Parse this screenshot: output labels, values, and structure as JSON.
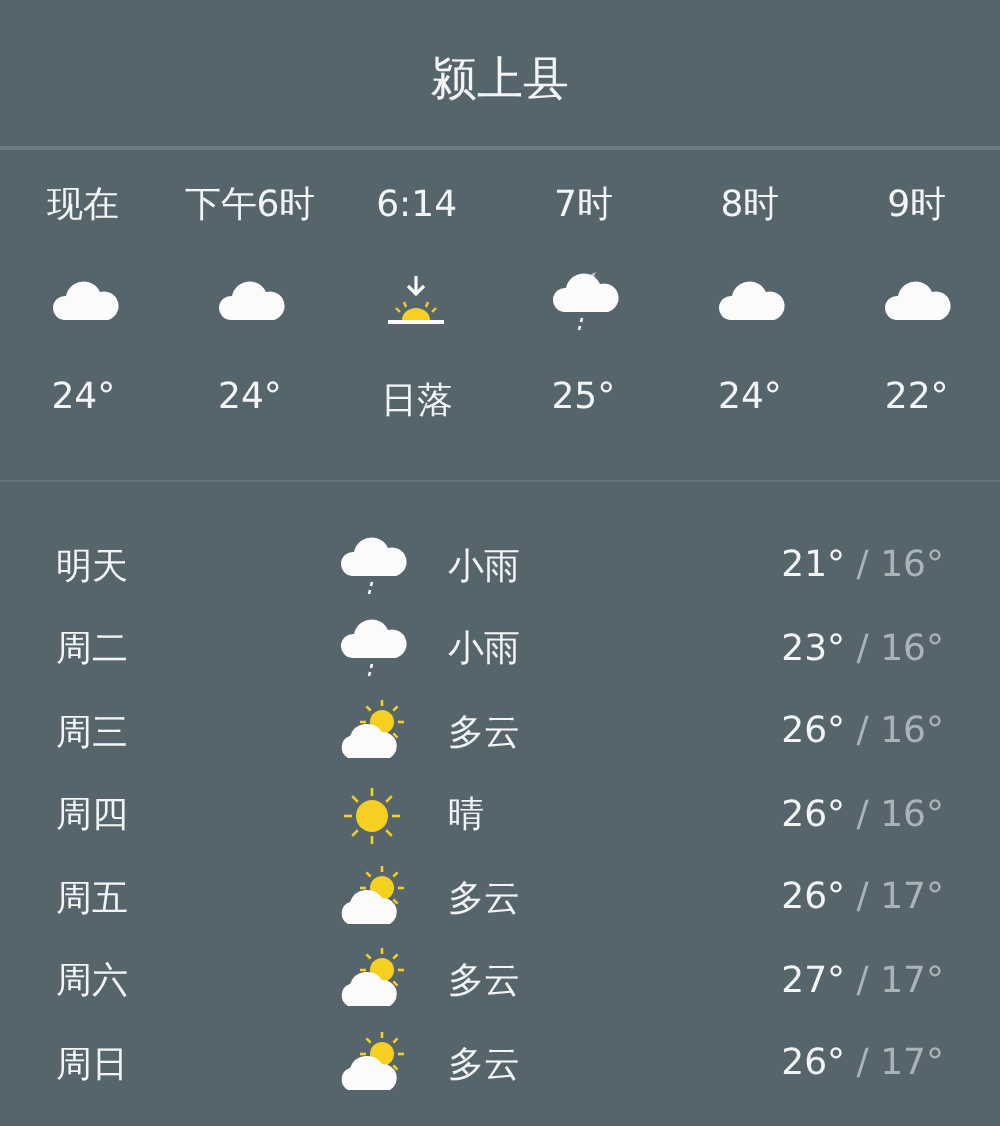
{
  "title": "颍上县",
  "hourly": [
    {
      "time": "现在",
      "kind": "cloud",
      "value": "24°"
    },
    {
      "time": "下午6时",
      "kind": "cloud",
      "value": "24°"
    },
    {
      "time": "6:14",
      "kind": "sunset",
      "value": "日落"
    },
    {
      "time": "7时",
      "kind": "moon",
      "value": "25°"
    },
    {
      "time": "8时",
      "kind": "cloud",
      "value": "24°"
    },
    {
      "time": "9时",
      "kind": "cloud",
      "value": "22°"
    }
  ],
  "daily": [
    {
      "day": "明天",
      "kind": "rain",
      "condition": "小雨",
      "high": "21°",
      "low": "/ 16°"
    },
    {
      "day": "周二",
      "kind": "rain",
      "condition": "小雨",
      "high": "23°",
      "low": "/ 16°"
    },
    {
      "day": "周三",
      "kind": "partly",
      "condition": "多云",
      "high": "26°",
      "low": "/ 16°"
    },
    {
      "day": "周四",
      "kind": "sun",
      "condition": "晴",
      "high": "26°",
      "low": "/ 16°"
    },
    {
      "day": "周五",
      "kind": "partly",
      "condition": "多云",
      "high": "26°",
      "low": "/ 17°"
    },
    {
      "day": "周六",
      "kind": "partly",
      "condition": "多云",
      "high": "27°",
      "low": "/ 17°"
    },
    {
      "day": "周日",
      "kind": "partly",
      "condition": "多云",
      "high": "26°",
      "low": "/ 17°"
    }
  ]
}
